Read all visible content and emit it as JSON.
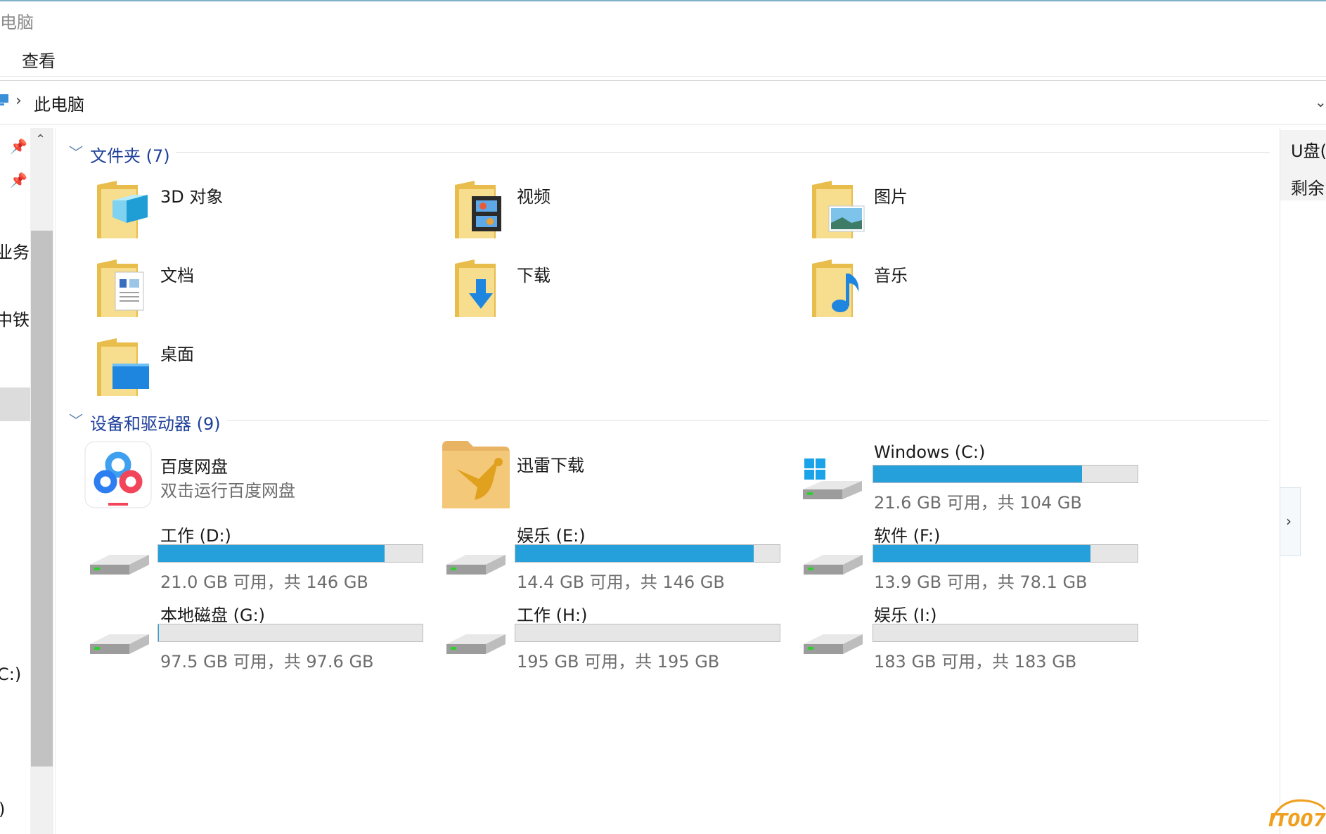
{
  "window": {
    "title": "电脑"
  },
  "ribbon": {
    "tab_view": "查看"
  },
  "address": {
    "crumb": "此电脑"
  },
  "nav": {
    "items": [
      "业务工",
      "中铁建",
      "C:)",
      ")"
    ]
  },
  "folders": {
    "header": "文件夹 (7)",
    "items": [
      {
        "name": "3D 对象",
        "icon": "3d-objects-folder-icon"
      },
      {
        "name": "视频",
        "icon": "videos-folder-icon"
      },
      {
        "name": "图片",
        "icon": "pictures-folder-icon"
      },
      {
        "name": "文档",
        "icon": "documents-folder-icon"
      },
      {
        "name": "下载",
        "icon": "downloads-folder-icon"
      },
      {
        "name": "音乐",
        "icon": "music-folder-icon"
      },
      {
        "name": "桌面",
        "icon": "desktop-folder-icon"
      }
    ]
  },
  "devices": {
    "header": "设备和驱动器 (9)",
    "apps": [
      {
        "name": "百度网盘",
        "sub": "双击运行百度网盘",
        "icon": "baidu-netdisk-icon"
      },
      {
        "name": "迅雷下载",
        "icon": "xunlei-icon"
      }
    ],
    "drives": [
      {
        "name": "Windows  (C:)",
        "info": "21.6 GB 可用，共 104 GB",
        "used_fraction": 0.79,
        "icon": "windows-drive-icon"
      },
      {
        "name": "工作 (D:)",
        "info": "21.0 GB 可用，共 146 GB",
        "used_fraction": 0.856,
        "icon": "hard-drive-icon"
      },
      {
        "name": "娱乐 (E:)",
        "info": "14.4 GB 可用，共 146 GB",
        "used_fraction": 0.901,
        "icon": "hard-drive-icon"
      },
      {
        "name": "软件 (F:)",
        "info": "13.9 GB 可用，共 78.1 GB",
        "used_fraction": 0.822,
        "icon": "hard-drive-icon"
      },
      {
        "name": "本地磁盘 (G:)",
        "info": "97.5 GB 可用，共 97.6 GB",
        "used_fraction": 0.001,
        "icon": "hard-drive-icon"
      },
      {
        "name": "工作 (H:)",
        "info": "195 GB 可用，共 195 GB",
        "used_fraction": 0.0,
        "icon": "hard-drive-icon"
      },
      {
        "name": "娱乐 (I:)",
        "info": "183 GB 可用，共 183 GB",
        "used_fraction": 0.0,
        "icon": "hard-drive-icon"
      }
    ]
  },
  "details": {
    "line1": "U盘(",
    "line2": "剩余"
  },
  "watermark": "IT007",
  "colors": {
    "bar_fill": "#26a0da",
    "section_title": "#1e3f9a",
    "folder": "#f5d27a"
  }
}
